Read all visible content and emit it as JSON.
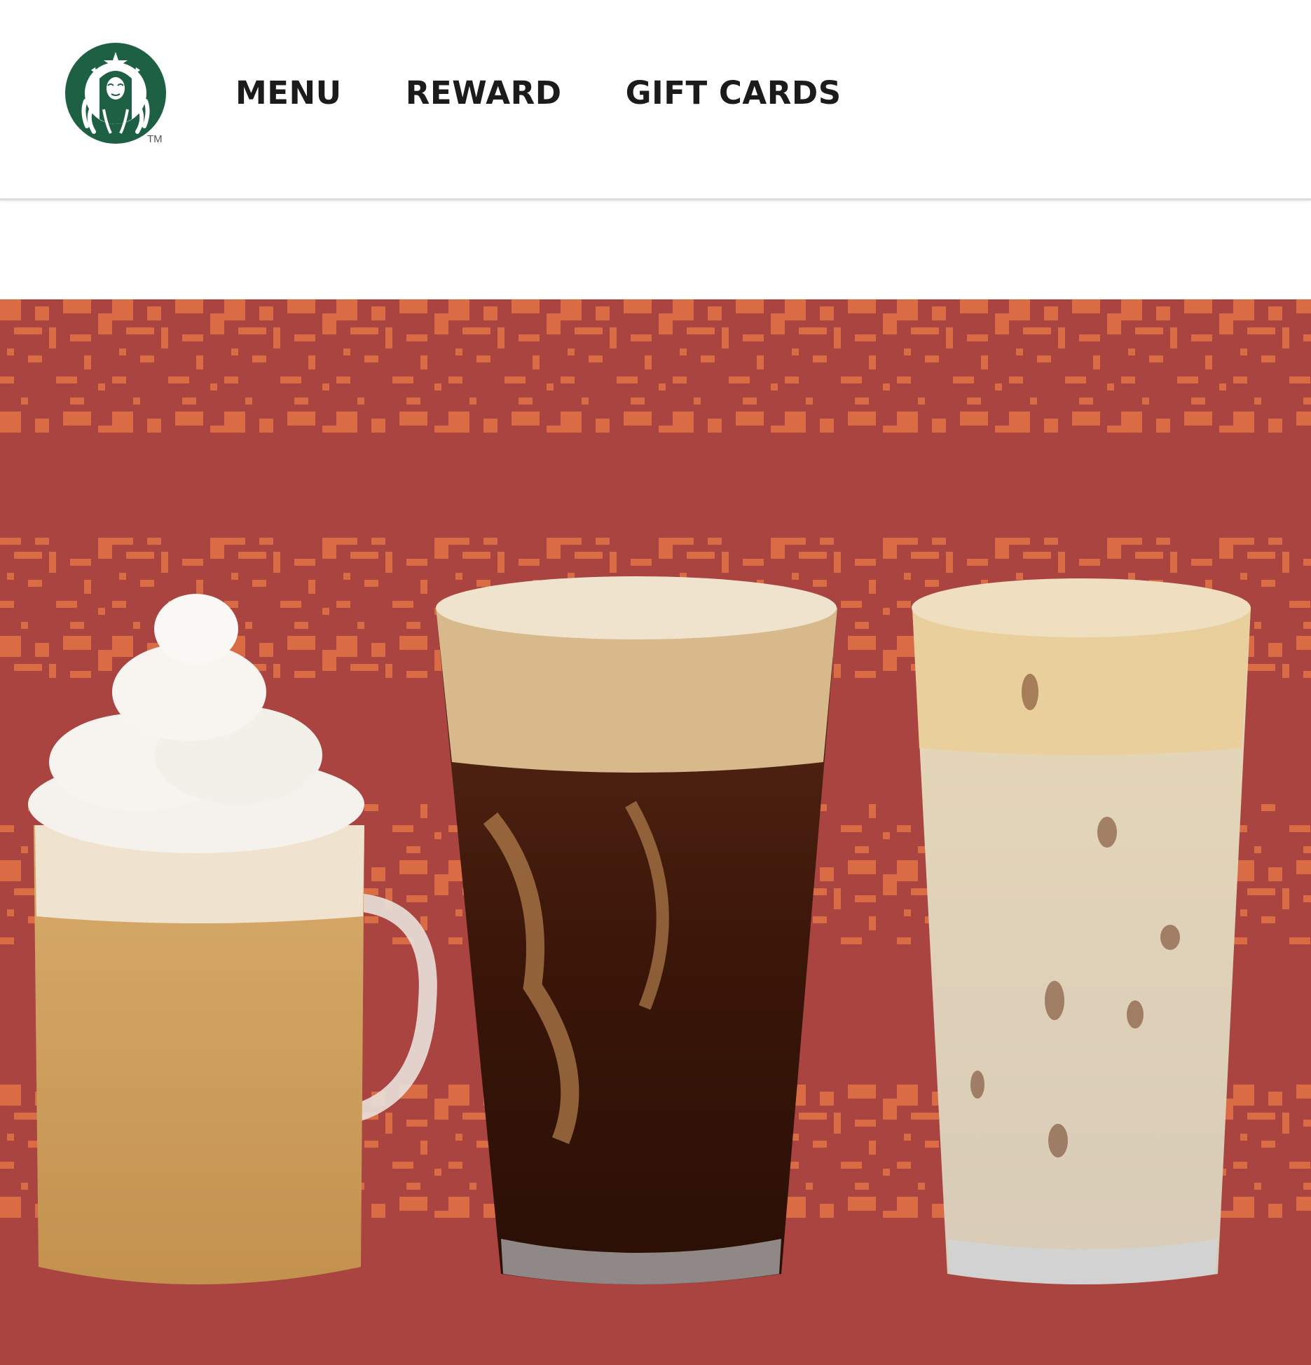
{
  "header": {
    "logo": {
      "icon": "starbucks-siren-logo-icon",
      "trademark": "TM"
    },
    "nav": [
      {
        "label": "MENU"
      },
      {
        "label": "REWARD"
      },
      {
        "label": "GIFT CARDS"
      }
    ]
  },
  "hero": {
    "image": "holiday-drinks-hero-image",
    "background_colors": {
      "base": "#a94441",
      "pattern": "#d96b45"
    },
    "drinks": [
      {
        "icon": "whipped-latte-mug-icon"
      },
      {
        "icon": "cold-brew-glass-icon"
      },
      {
        "icon": "iced-latte-glass-icon"
      }
    ]
  },
  "colors": {
    "brand_green": "#1e6043",
    "nav_text": "#1b1b1b"
  }
}
